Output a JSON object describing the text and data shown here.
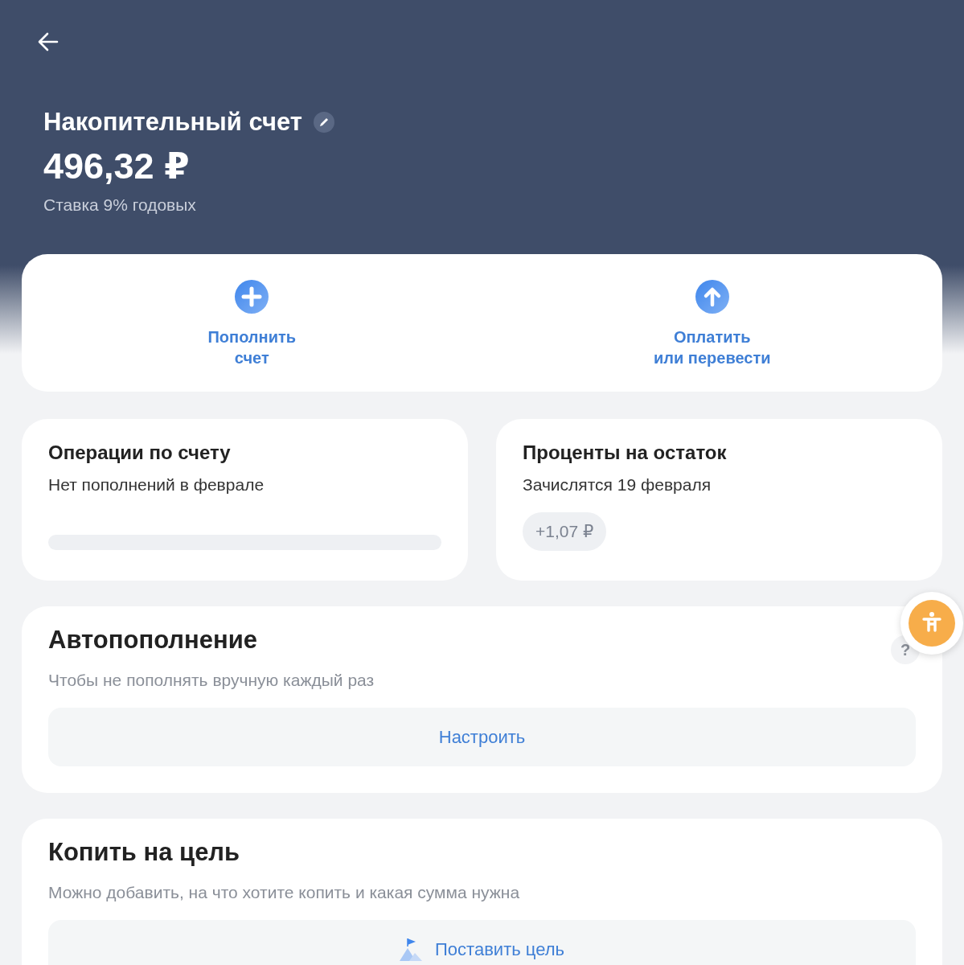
{
  "header": {
    "title": "Накопительный счет",
    "balance": "496,32 ₽",
    "rate": "Ставка 9% годовых"
  },
  "actions": [
    {
      "kind": "plus",
      "lines": [
        "Пополнить",
        "счет"
      ]
    },
    {
      "kind": "up",
      "lines": [
        "Оплатить",
        "или перевести"
      ]
    }
  ],
  "summary_cards": [
    {
      "kind": "bar",
      "title": "Операции по счету",
      "subtitle": "Нет пополнений в феврале"
    },
    {
      "kind": "chip",
      "title": "Проценты на остаток",
      "subtitle": "Зачислятся 19 февраля",
      "chip": "+1,07 ₽"
    }
  ],
  "sections": [
    {
      "kind": "plain",
      "title": "Автопополнение",
      "subtitle": "Чтобы не пополнять вручную каждый раз",
      "button": "Настроить"
    },
    {
      "kind": "goal",
      "title": "Копить на цель",
      "subtitle": "Можно добавить, на что хотите копить и какая сумма нужна",
      "button": "Поставить цель"
    }
  ],
  "help": {
    "label": "?"
  }
}
